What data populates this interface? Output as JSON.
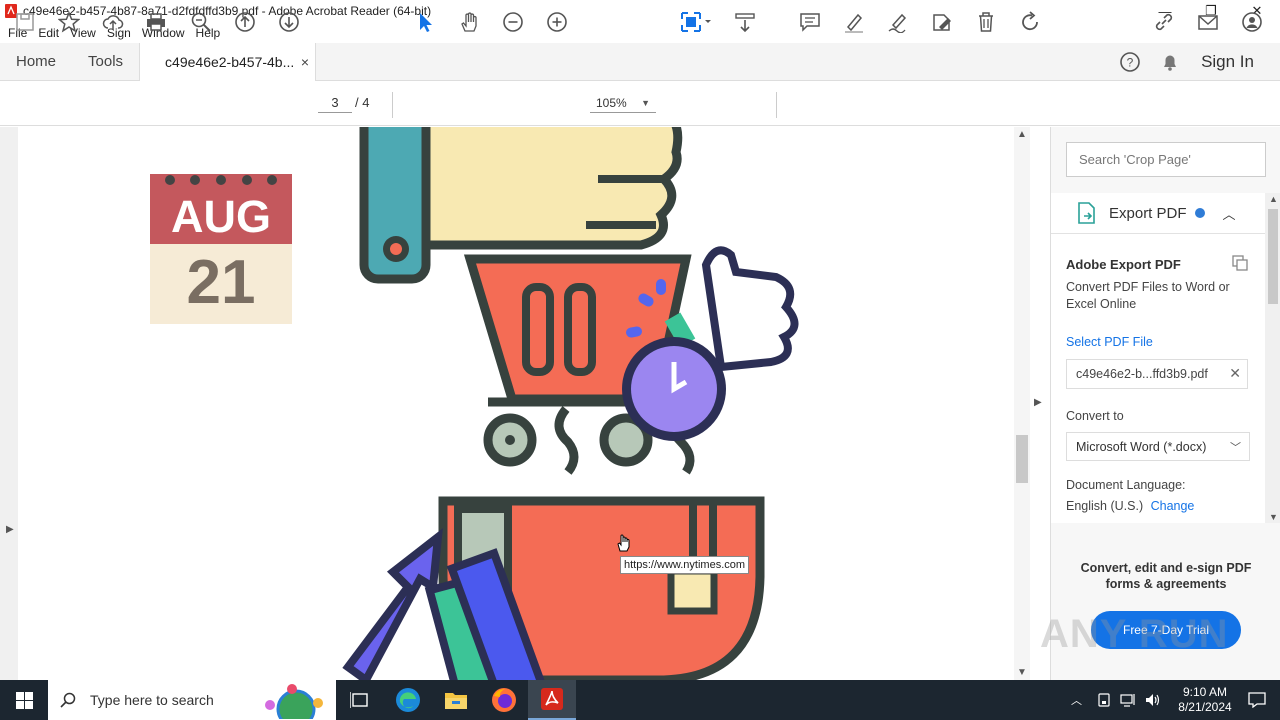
{
  "window": {
    "title": "c49e46e2-b457-4b87-8a71-d2fdfdffd3b9.pdf - Adobe Acrobat Reader (64-bit)",
    "minimize": "—",
    "restore": "❐",
    "close": "✕"
  },
  "menu": [
    "File",
    "Edit",
    "View",
    "Sign",
    "Window",
    "Help"
  ],
  "tabs": {
    "home": "Home",
    "tools": "Tools",
    "doc": "c49e46e2-b457-4b...",
    "doc_close": "×",
    "sign_in": "Sign In"
  },
  "toolbar": {
    "page_current": "3",
    "page_total": "/ 4",
    "zoom": "105%"
  },
  "document": {
    "calendar_month": "AUG",
    "calendar_day": "21",
    "tooltip": "https://www.nytimes.com"
  },
  "right_pane": {
    "search_placeholder": "Search 'Crop Page'",
    "export_title": "Export PDF",
    "aep_title": "Adobe Export PDF",
    "aep_desc": "Convert PDF Files to Word or Excel Online",
    "select_file_label": "Select PDF File",
    "file_name": "c49e46e2-b...ffd3b9.pdf",
    "convert_to_label": "Convert to",
    "convert_to_value": "Microsoft Word (*.docx)",
    "doc_lang_label": "Document Language:",
    "doc_lang_value": "English (U.S.)",
    "change_link": "Change",
    "promo_text": "Convert, edit and e-sign PDF forms & agreements",
    "trial_button": "Free 7-Day Trial"
  },
  "watermark": "ANY RUN",
  "taskbar": {
    "search_placeholder": "Type here to search",
    "time": "9:10 AM",
    "date": "8/21/2024"
  },
  "colors": {
    "accent": "#1473e6",
    "taskbar": "#1c2630"
  }
}
